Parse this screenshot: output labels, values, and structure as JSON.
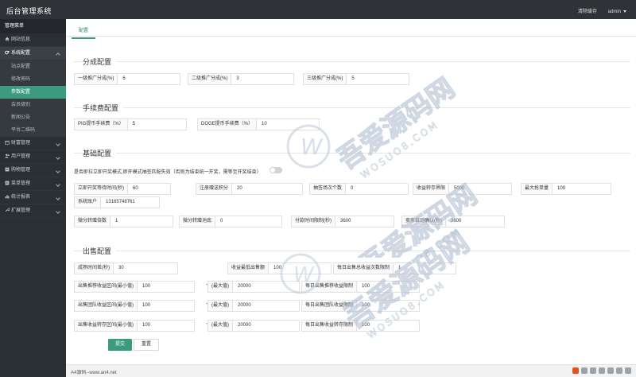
{
  "header": {
    "title": "后台管理系统",
    "clear_cache": "清除缓存",
    "user": "admin"
  },
  "sidebar": {
    "heading": "管理菜单",
    "items": [
      {
        "label": "网站信息",
        "icon": "home-icon"
      },
      {
        "label": "系统配置",
        "icon": "gears-icon",
        "open": true,
        "children": [
          {
            "label": "站点配置"
          },
          {
            "label": "修改密码"
          },
          {
            "label": "参数配置",
            "active": true
          },
          {
            "label": "会员级别"
          },
          {
            "label": "新闻公告"
          },
          {
            "label": "平台二维码"
          }
        ]
      },
      {
        "label": "财富管理",
        "icon": "calendar-icon"
      },
      {
        "label": "用户管理",
        "icon": "users-icon"
      },
      {
        "label": "购物管理",
        "icon": "list-icon"
      },
      {
        "label": "菜单管理",
        "icon": "list-icon"
      },
      {
        "label": "统计报表",
        "icon": "chart-icon"
      },
      {
        "label": "扩展管理",
        "icon": "wrench-icon"
      }
    ]
  },
  "main": {
    "tab": "配置",
    "sections": {
      "fencheng": {
        "title": "分成配置",
        "fields": [
          {
            "label": "一级推广分成(%)",
            "value": "6"
          },
          {
            "label": "二级推广分成(%)",
            "value": "3"
          },
          {
            "label": "三级推广分成(%)",
            "value": "5"
          }
        ]
      },
      "fee": {
        "title": "手续费配置",
        "fields": [
          {
            "label": "PIG提币手续费（%）",
            "value": "5"
          },
          {
            "label": "DOGE提币手续费（%）",
            "value": "10"
          }
        ]
      },
      "basic": {
        "title": "基础配置",
        "toggle_label": "是否即拉立即开奖模式,即开模式抽签匹配失效（否则为结束统一开奖，需等至开奖结束）",
        "row1": [
          {
            "label": "立即开奖等待时间(秒)",
            "value": "60"
          },
          {
            "label": "注册赠送积分",
            "value": "20"
          },
          {
            "label": "抽签场次个数",
            "value": "0"
          },
          {
            "label": "收益转存界限",
            "value": "5000"
          },
          {
            "label": "最大抢单量",
            "value": "100"
          }
        ],
        "system_account": {
          "label": "系统账户",
          "value": "13165748761"
        },
        "row3": [
          {
            "label": "微分转赠倍数",
            "value": "1"
          },
          {
            "label": "微分转赠池底",
            "value": "0"
          },
          {
            "label": "付款时间限制(秒)",
            "value": "3600"
          },
          {
            "label": "卖家自动确认(秒)",
            "value": "3600"
          }
        ]
      },
      "sale": {
        "title": "出售配置",
        "row1": [
          {
            "label": "成熟时间差(秒)",
            "value": "30"
          },
          {
            "label": "收益最低出售额",
            "value": "100"
          },
          {
            "label": "每日出售总收益次数限制",
            "value": "1"
          }
        ],
        "ranges": [
          {
            "label": "出售推荐收益区间(最小值)",
            "min": "100",
            "max_label": "(最大值)",
            "max": "20000",
            "limit_label": "每日出售推荐收益限制",
            "limit": "100"
          },
          {
            "label": "出售团队收益区间(最小值)",
            "min": "100",
            "max_label": "(最大值)",
            "max": "20000",
            "limit_label": "每日出售团队收益限制",
            "limit": "100"
          },
          {
            "label": "出售收益转存区间(最小值)",
            "min": "100",
            "max_label": "(最大值)",
            "max": "20000",
            "limit_label": "每日出售收益转存限制",
            "limit": "100"
          }
        ],
        "dash": "-"
      }
    },
    "submit": "提交",
    "reset": "重置"
  },
  "footer": {
    "text": "A4源码--www.an4.net"
  },
  "watermark": {
    "brand_cn": "吾爱源码网",
    "brand_en": "WOSUO8.COM"
  },
  "colors": {
    "accent": "#3c9a7f",
    "topbar": "#2f3337",
    "sidebar": "#2a2f33"
  }
}
